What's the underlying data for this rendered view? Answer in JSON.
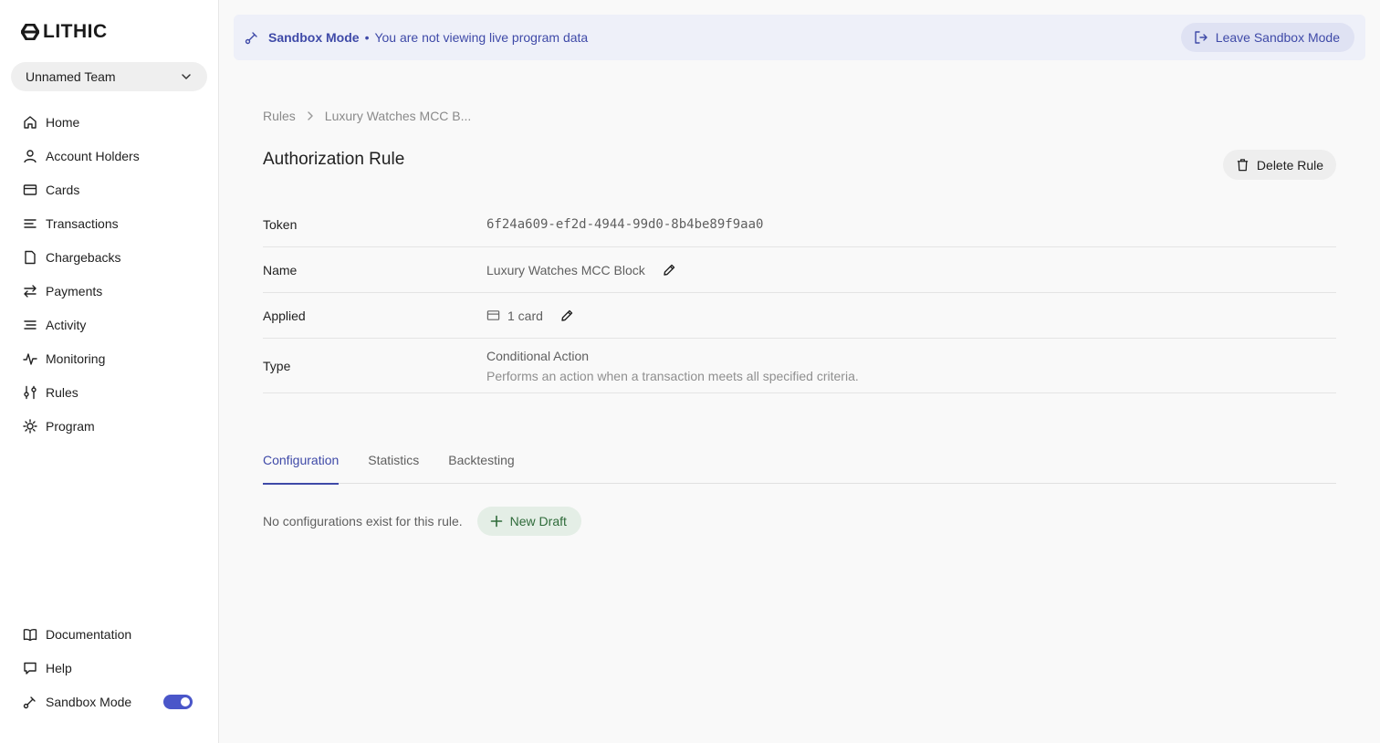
{
  "brand": {
    "name": "LITHIC",
    "accent": "#4a56c9"
  },
  "team": {
    "selected": "Unnamed Team"
  },
  "sidebar": {
    "items": [
      {
        "label": "Home",
        "icon": "home-icon"
      },
      {
        "label": "Account Holders",
        "icon": "user-icon"
      },
      {
        "label": "Cards",
        "icon": "card-icon"
      },
      {
        "label": "Transactions",
        "icon": "list-icon"
      },
      {
        "label": "Chargebacks",
        "icon": "document-icon"
      },
      {
        "label": "Payments",
        "icon": "transfer-icon"
      },
      {
        "label": "Activity",
        "icon": "activity-list-icon"
      },
      {
        "label": "Monitoring",
        "icon": "pulse-icon"
      },
      {
        "label": "Rules",
        "icon": "sliders-icon"
      },
      {
        "label": "Program",
        "icon": "gear-icon"
      }
    ],
    "bottom": [
      {
        "label": "Documentation",
        "icon": "book-icon"
      },
      {
        "label": "Help",
        "icon": "chat-icon"
      },
      {
        "label": "Sandbox Mode",
        "icon": "sandbox-icon",
        "toggle": true
      }
    ]
  },
  "banner": {
    "title": "Sandbox Mode",
    "separator": "•",
    "message": "You are not viewing live program data",
    "leave_label": "Leave Sandbox Mode"
  },
  "breadcrumb": {
    "parent": "Rules",
    "current": "Luxury Watches MCC B..."
  },
  "page": {
    "title": "Authorization Rule",
    "delete_label": "Delete Rule"
  },
  "details": {
    "token": {
      "label": "Token",
      "value": "6f24a609-ef2d-4944-99d0-8b4be89f9aa0"
    },
    "name": {
      "label": "Name",
      "value": "Luxury Watches MCC Block"
    },
    "applied": {
      "label": "Applied",
      "value": "1 card"
    },
    "type": {
      "label": "Type",
      "value": "Conditional Action",
      "description": "Performs an action when a transaction meets all specified criteria."
    }
  },
  "tabs": [
    {
      "label": "Configuration",
      "active": true
    },
    {
      "label": "Statistics",
      "active": false
    },
    {
      "label": "Backtesting",
      "active": false
    }
  ],
  "empty_state": {
    "message": "No configurations exist for this rule.",
    "new_draft_label": "New Draft"
  }
}
